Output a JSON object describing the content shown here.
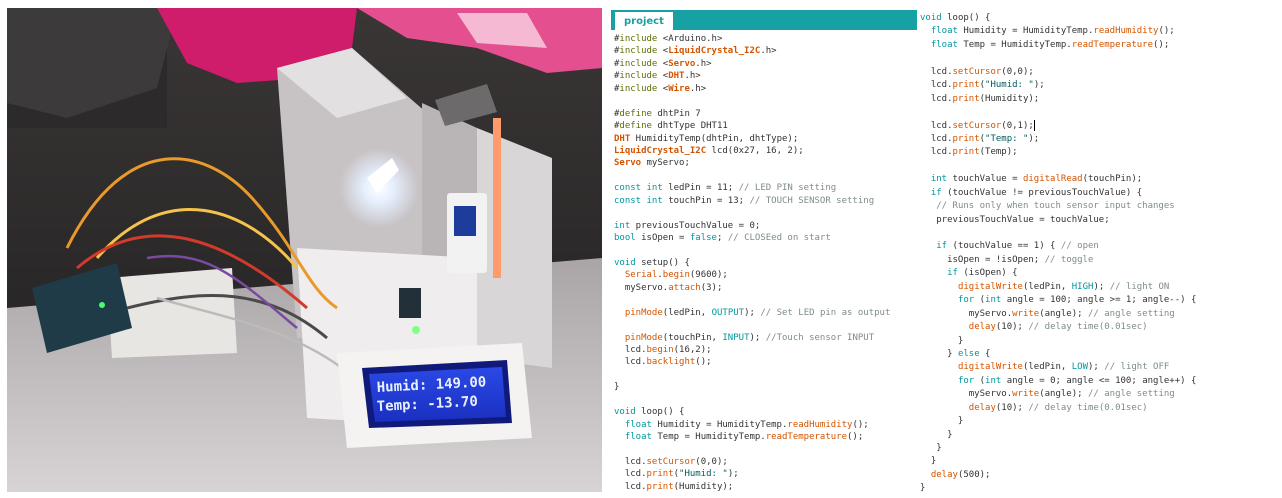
{
  "editor": {
    "tab_label": "project",
    "accent_color": "#17a1a5"
  },
  "photo": {
    "lcd_line1": "Humid: 149.00",
    "lcd_line2": "Temp: -13.70"
  },
  "code_left": [
    "#include <Arduino.h>",
    "#include <LiquidCrystal_I2C.h>",
    "#include <Servo.h>",
    "#include <DHT.h>",
    "#include <Wire.h>",
    "",
    "#define dhtPin 7",
    "#define dhtType DHT11",
    "DHT HumidityTemp(dhtPin, dhtType);",
    "LiquidCrystal_I2C lcd(0x27, 16, 2);",
    "Servo myServo;",
    "",
    "const int ledPin = 11; // LED PIN setting",
    "const int touchPin = 13; // TOUCH SENSOR setting",
    "",
    "int previousTouchValue = 0;",
    "bool isOpen = false; // CLOSEed on start",
    "",
    "void setup() {",
    "  Serial.begin(9600);",
    "  myServo.attach(3);",
    "",
    "  pinMode(ledPin, OUTPUT); // Set LED pin as output",
    "",
    "  pinMode(touchPin, INPUT); //Touch sensor INPUT",
    "  lcd.begin(16,2);",
    "  lcd.backlight();",
    "",
    "}",
    "",
    "void loop() {",
    "  float Humidity = HumidityTemp.readHumidity();",
    "  float Temp = HumidityTemp.readTemperature();",
    "",
    "  lcd.setCursor(0,0);",
    "  lcd.print(\"Humid: \");",
    "  lcd.print(Humidity);"
  ],
  "code_right": [
    "void loop() {",
    "  float Humidity = HumidityTemp.readHumidity();",
    "  float Temp = HumidityTemp.readTemperature();",
    "",
    "  lcd.setCursor(0,0);",
    "  lcd.print(\"Humid: \");",
    "  lcd.print(Humidity);",
    "",
    "  lcd.setCursor(0,1);",
    "  lcd.print(\"Temp: \");",
    "  lcd.print(Temp);",
    "",
    "  int touchValue = digitalRead(touchPin);",
    "  if (touchValue != previousTouchValue) {",
    "   // Runs only when touch sensor input changes",
    "   previousTouchValue = touchValue;",
    "",
    "   if (touchValue == 1) { // open",
    "     isOpen = !isOpen; // toggle",
    "     if (isOpen) {",
    "       digitalWrite(ledPin, HIGH); // light ON",
    "       for (int angle = 100; angle >= 1; angle--) {",
    "         myServo.write(angle); // angle setting",
    "         delay(10); // delay time(0.01sec)",
    "       }",
    "     } else {",
    "       digitalWrite(ledPin, LOW); // light OFF",
    "       for (int angle = 0; angle <= 100; angle++) {",
    "         myServo.write(angle); // angle setting",
    "         delay(10); // delay time(0.01sec)",
    "       }",
    "     }",
    "   }",
    "  }",
    "  delay(500);",
    "}"
  ]
}
